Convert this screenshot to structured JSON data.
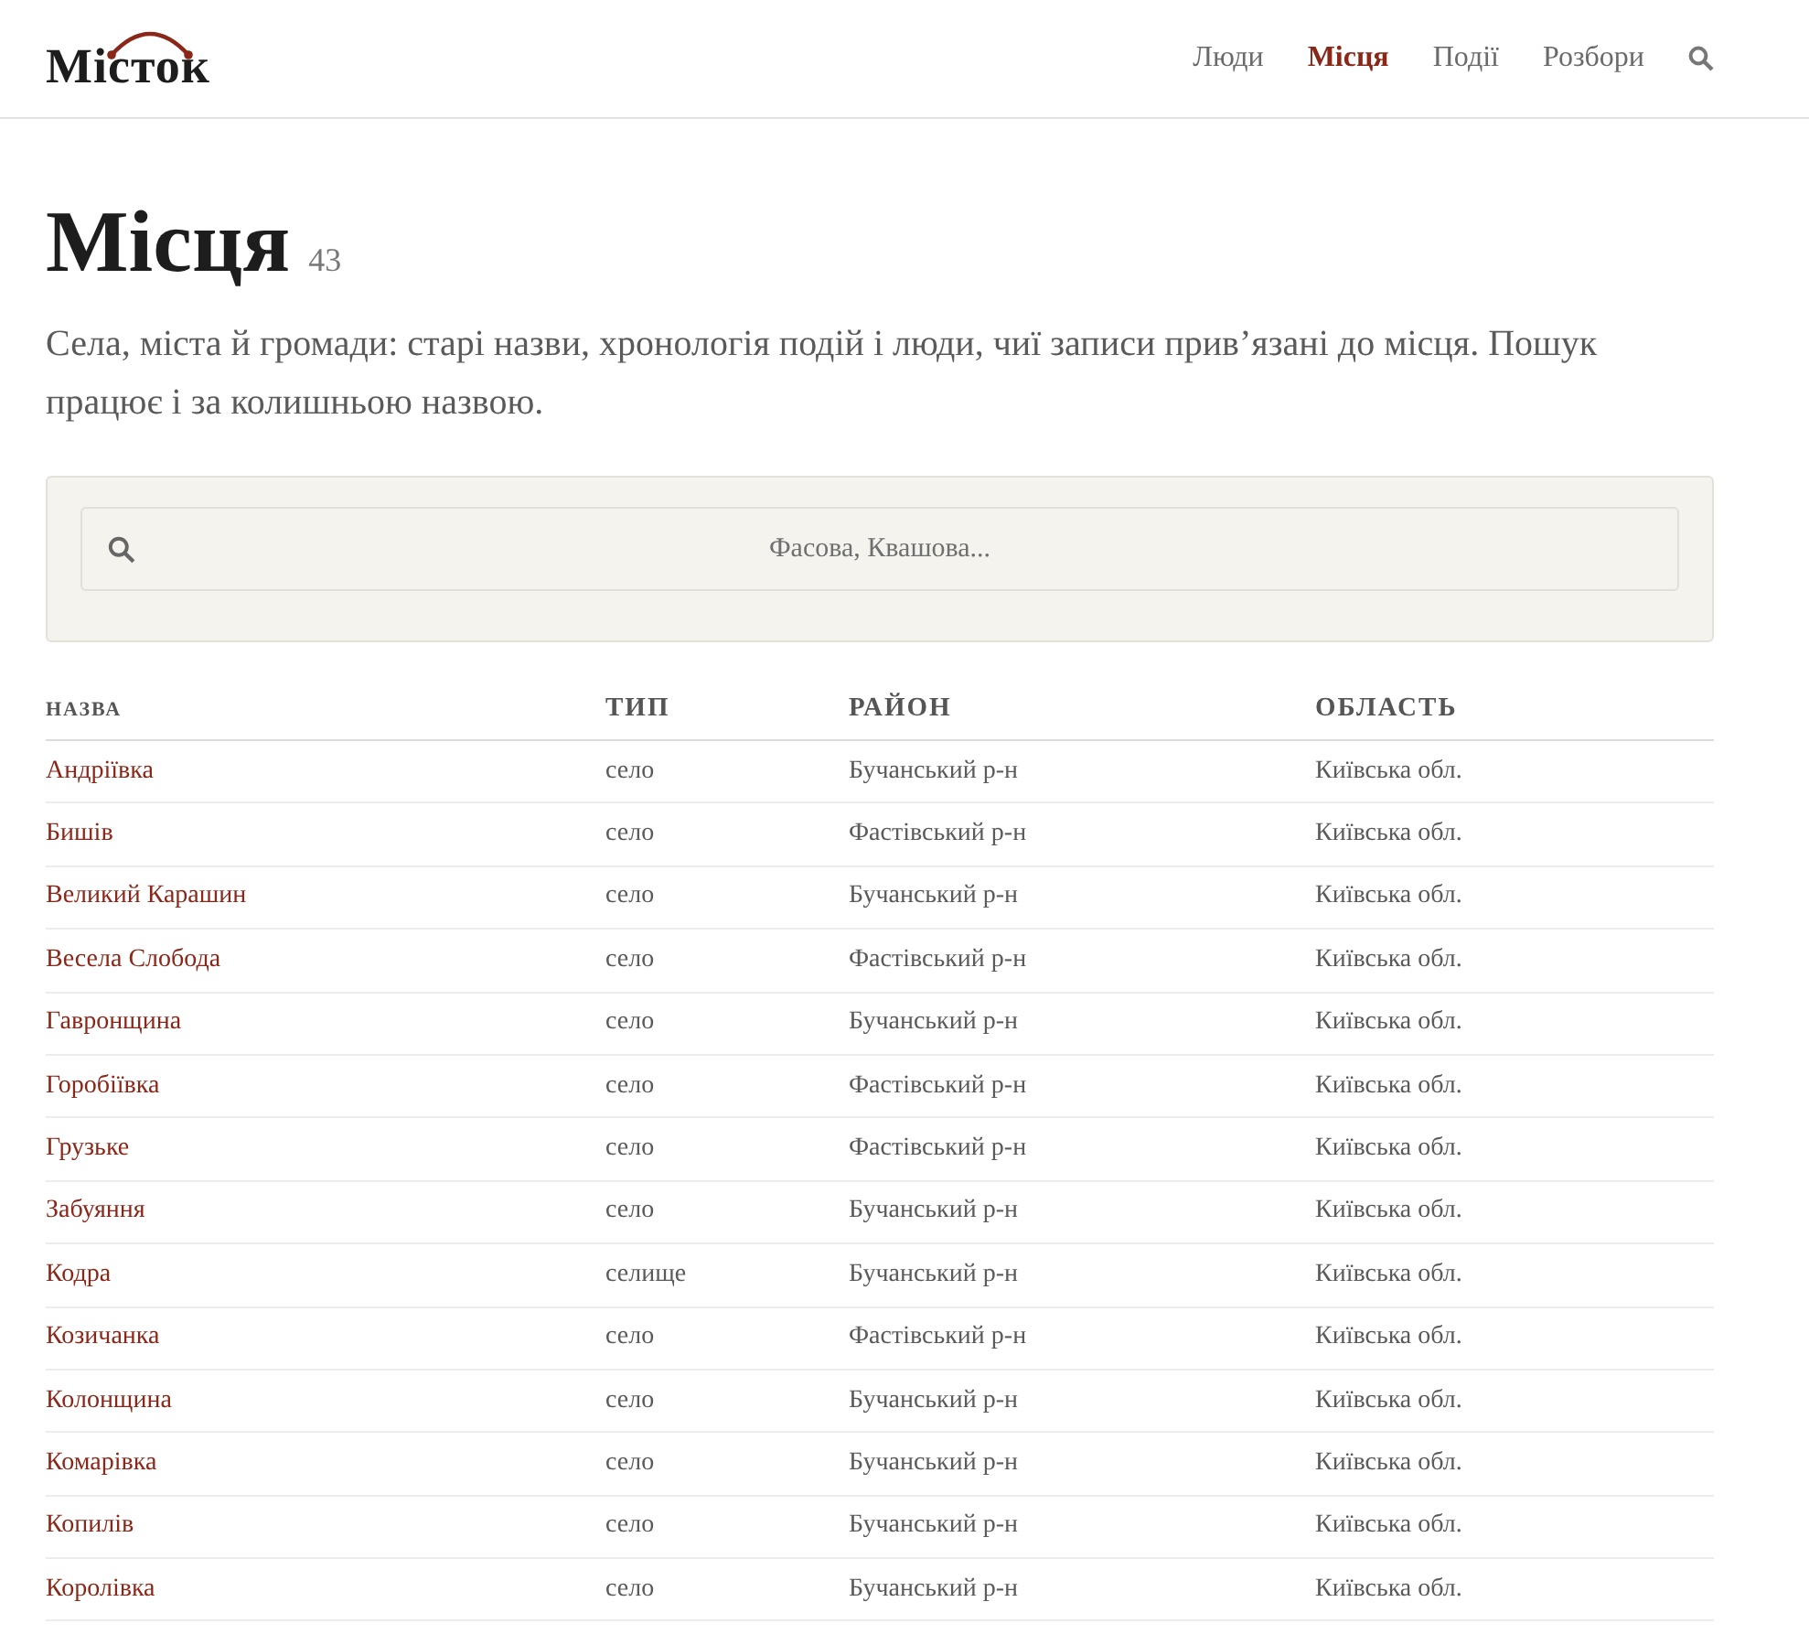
{
  "header": {
    "logo": "Місток",
    "nav": [
      {
        "label": "Люди",
        "selected": false
      },
      {
        "label": "Місця",
        "selected": true
      },
      {
        "label": "Події",
        "selected": false
      },
      {
        "label": "Розбори",
        "selected": false
      }
    ]
  },
  "page": {
    "title": "Місця",
    "count": "43",
    "description": "Села, міста й громади: старі назви, хронологія подій і люди, чиї записи прив’язані до місця. Пошук працює і за колишньою назвою."
  },
  "search": {
    "placeholder": "Фасова, Квашова..."
  },
  "table": {
    "columns": [
      "НАЗВА",
      "ТИП",
      "РАЙОН",
      "ОБЛАСТЬ"
    ],
    "rows": [
      [
        "Андріївка",
        "село",
        "Бучанський р-н",
        "Київська обл."
      ],
      [
        "Бишів",
        "село",
        "Фастівський р-н",
        "Київська обл."
      ],
      [
        "Великий Карашин",
        "село",
        "Бучанський р-н",
        "Київська обл."
      ],
      [
        "Весела Слобода",
        "село",
        "Фастівський р-н",
        "Київська обл."
      ],
      [
        "Гавронщина",
        "село",
        "Бучанський р-н",
        "Київська обл."
      ],
      [
        "Горобіївка",
        "село",
        "Фастівський р-н",
        "Київська обл."
      ],
      [
        "Грузьке",
        "село",
        "Фастівський р-н",
        "Київська обл."
      ],
      [
        "Забуяння",
        "село",
        "Бучанський р-н",
        "Київська обл."
      ],
      [
        "Кодра",
        "селище",
        "Бучанський р-н",
        "Київська обл."
      ],
      [
        "Козичанка",
        "село",
        "Фастівський р-н",
        "Київська обл."
      ],
      [
        "Колонщина",
        "село",
        "Бучанський р-н",
        "Київська обл."
      ],
      [
        "Комарівка",
        "село",
        "Бучанський р-н",
        "Київська обл."
      ],
      [
        "Копилів",
        "село",
        "Бучанський р-н",
        "Київська обл."
      ],
      [
        "Королівка",
        "село",
        "Бучанський р-н",
        "Київська обл."
      ]
    ]
  }
}
